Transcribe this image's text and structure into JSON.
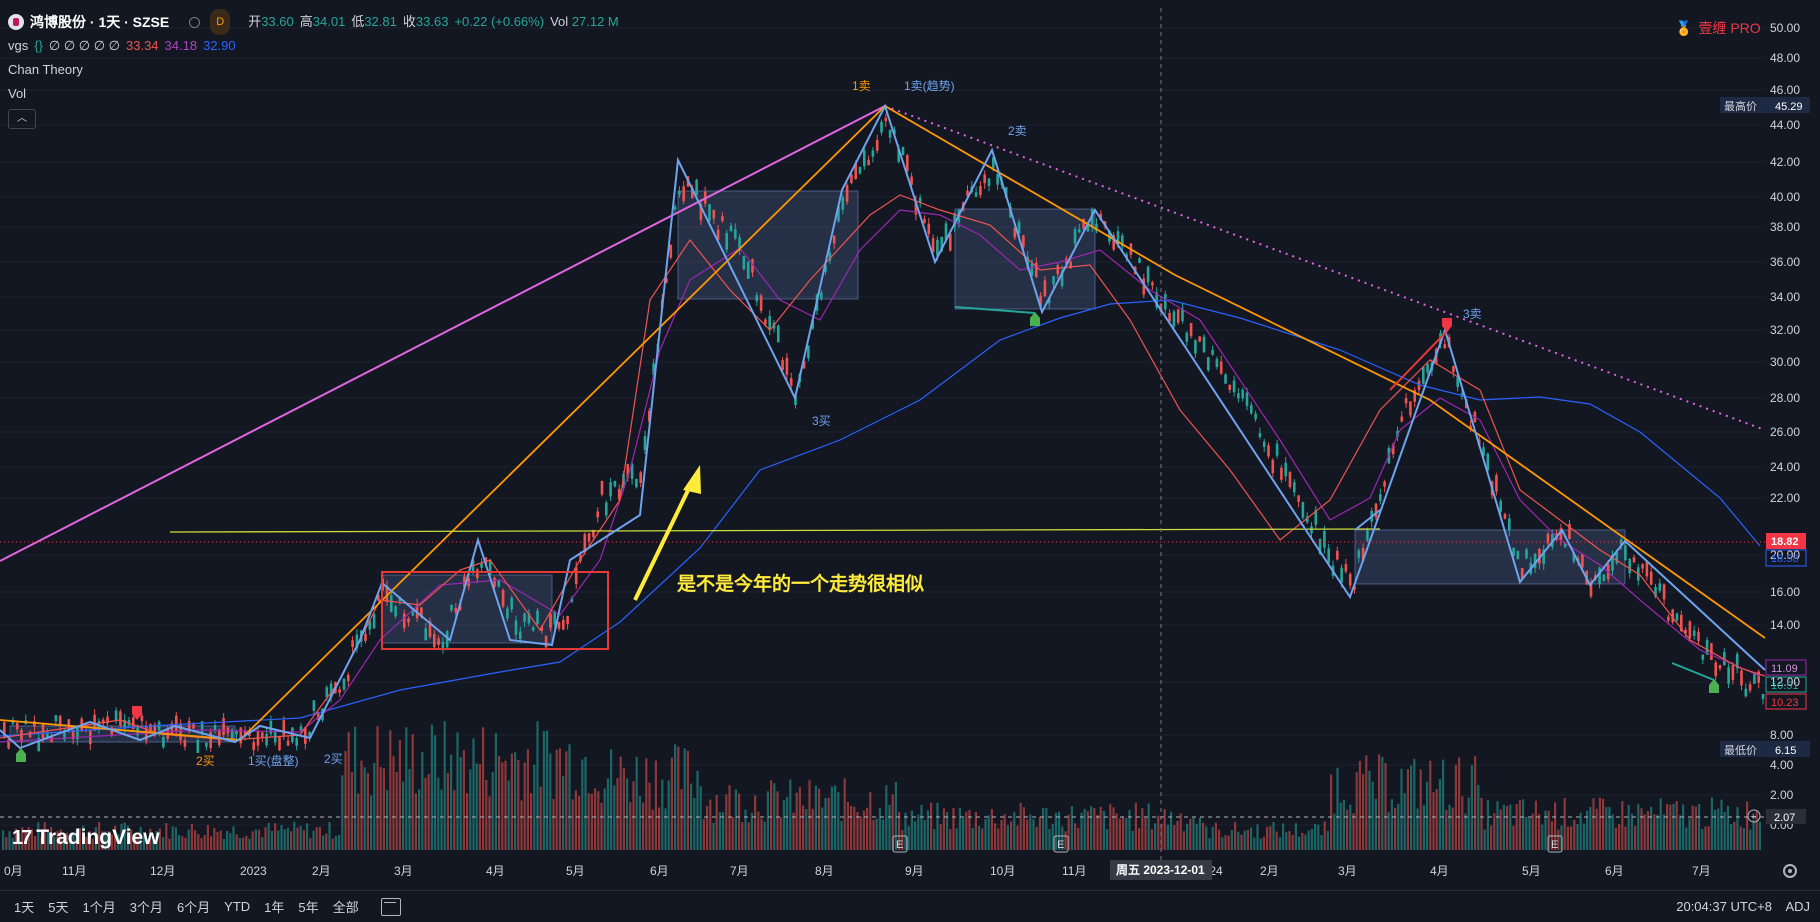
{
  "header": {
    "symbol": "鸿博股份 · 1天 · SZSE",
    "badge": "D",
    "ohlc": [
      {
        "label": "开",
        "value": "33.60"
      },
      {
        "label": "高",
        "value": "34.01"
      },
      {
        "label": "低",
        "value": "32.81"
      },
      {
        "label": "收",
        "value": "33.63"
      }
    ],
    "change": "+0.22 (+0.66%)",
    "vol_label": "Vol",
    "vol_value": "27.12 M"
  },
  "indicators": {
    "vgs": {
      "name": "vgs",
      "braces": "{}",
      "nulls": "∅ ∅ ∅ ∅ ∅",
      "v1": "33.34",
      "v2": "34.18",
      "v3": "32.90"
    },
    "chan": "Chan Theory",
    "vol": "Vol",
    "collapse_icon": "chevron-up-icon"
  },
  "top_right": {
    "label": "壹缠 PRO",
    "icon": "medal-icon"
  },
  "annotation_text": "是不是今年的一个走势很相似",
  "chart_labels": {
    "sell1": "1卖",
    "sell1_trend": "1卖(趋势)",
    "sell2": "2卖",
    "sell3": "3卖",
    "buy3": "3买",
    "buy2a": "2买",
    "buy1": "1买(盘整)",
    "buy2b": "2买"
  },
  "price_axis": {
    "ticks": [
      "50.00",
      "48.00",
      "46.00",
      "44.00",
      "42.00",
      "40.00",
      "38.00",
      "36.00",
      "34.00",
      "32.00",
      "30.00",
      "28.00",
      "26.00",
      "24.00",
      "22.00",
      "20.00",
      "16.00",
      "14.00",
      "12.00",
      "8.00",
      "4.00",
      "2.00",
      "0.00"
    ],
    "high_label": "最高价",
    "high_value": "45.29",
    "low_label": "最低价",
    "low_value": "6.15",
    "cur_price": "18.82",
    "ma_value": "18.58",
    "p1": "11.09",
    "p2": "10.51",
    "p3": "10.23",
    "vol_value": "2.07"
  },
  "time_axis": {
    "ticks": [
      "0月",
      "11月",
      "12月",
      "2023",
      "2月",
      "3月",
      "4月",
      "5月",
      "6月",
      "7月",
      "8月",
      "9月",
      "10月",
      "11月",
      "2024",
      "2月",
      "3月",
      "4月",
      "5月",
      "6月",
      "7月"
    ],
    "crosshair": "周五 2023-12-01"
  },
  "earnings_marker": "E",
  "bottom_bar": {
    "timeframes": [
      "1天",
      "5天",
      "1个月",
      "3个月",
      "6个月",
      "YTD",
      "1年",
      "5年",
      "全部"
    ],
    "clock": "20:04:37 UTC+8",
    "adj": "ADJ"
  },
  "brand": "TradingView",
  "colors": {
    "background": "#131722",
    "up": "#26a69a",
    "down": "#ef5350",
    "pink_line": "#e066e0",
    "orange_line": "#ff9800",
    "blue_stroke": "#6ea3ee",
    "yellow": "#ffeb3b",
    "red_box": "#e53935",
    "price_tag": "#f23645"
  }
}
